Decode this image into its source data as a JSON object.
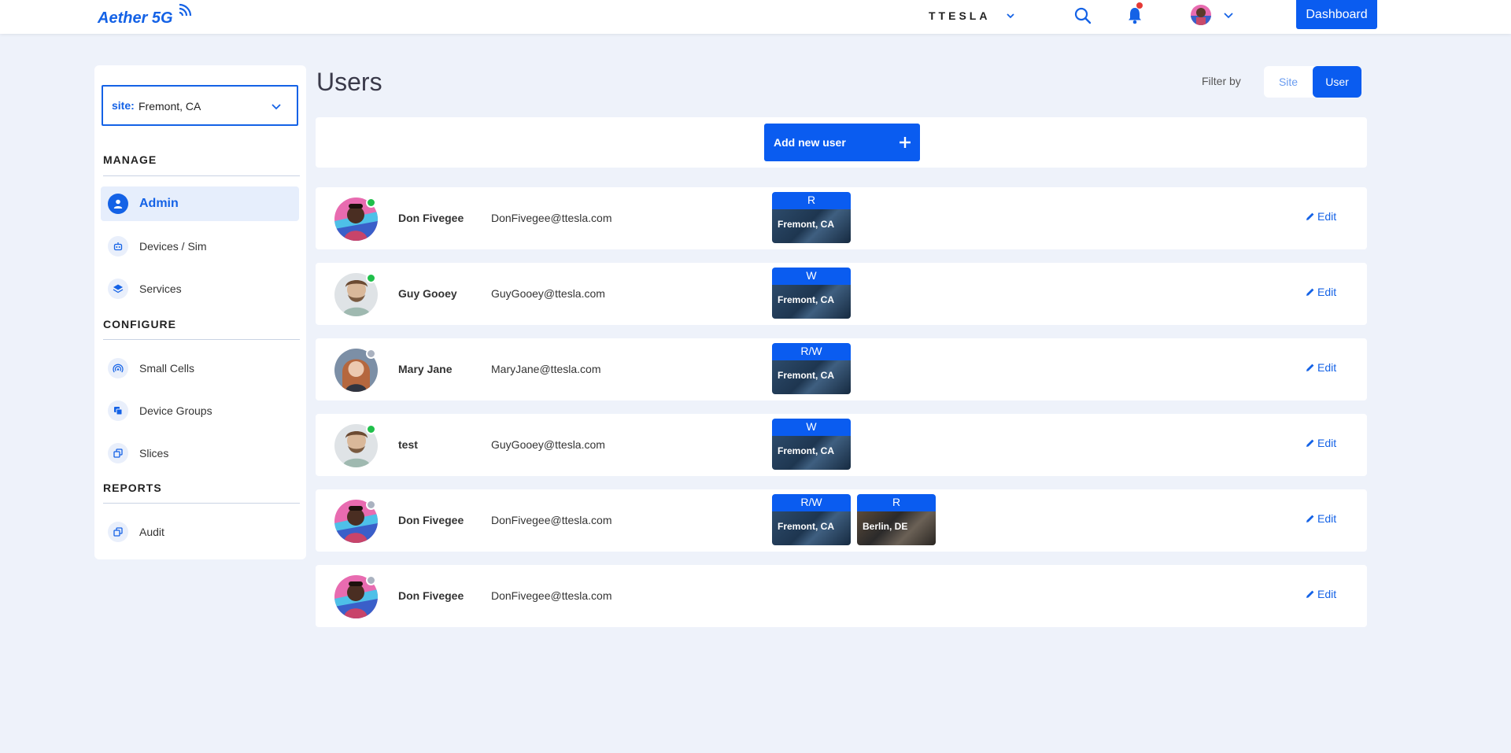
{
  "header": {
    "logo_text": "Aether 5G",
    "brand": "TTESLA",
    "dashboard_label": "Dashboard"
  },
  "sidebar": {
    "site_label": "site:",
    "site_value": "Fremont, CA",
    "sections": [
      {
        "title": "MANAGE",
        "items": [
          {
            "label": "Admin",
            "icon": "person-icon",
            "active": true
          },
          {
            "label": "Devices / Sim",
            "icon": "robot-icon"
          },
          {
            "label": "Services",
            "icon": "layers-icon"
          }
        ]
      },
      {
        "title": "CONFIGURE",
        "items": [
          {
            "label": "Small Cells",
            "icon": "signal-icon"
          },
          {
            "label": "Device Groups",
            "icon": "copy-icon"
          },
          {
            "label": "Slices",
            "icon": "stack-icon"
          }
        ]
      },
      {
        "title": "REPORTS",
        "items": [
          {
            "label": "Audit",
            "icon": "stack-icon"
          }
        ]
      }
    ]
  },
  "main": {
    "title": "Users",
    "filter_label": "Filter by",
    "filter_site": "Site",
    "filter_user": "User",
    "add_user_label": "Add new user",
    "edit_label": "Edit",
    "users": [
      {
        "name": "Don Fivegee",
        "email": "DonFivegee@ttesla.com",
        "status": "online",
        "avatar": "don",
        "sites": [
          {
            "perm": "R",
            "city": "Fremont, CA"
          }
        ]
      },
      {
        "name": "Guy Gooey",
        "email": "GuyGooey@ttesla.com",
        "status": "online",
        "avatar": "guy",
        "sites": [
          {
            "perm": "W",
            "city": "Fremont, CA"
          }
        ]
      },
      {
        "name": "Mary Jane",
        "email": "MaryJane@ttesla.com",
        "status": "offline",
        "avatar": "mary",
        "sites": [
          {
            "perm": "R/W",
            "city": "Fremont, CA"
          }
        ]
      },
      {
        "name": "test",
        "email": "GuyGooey@ttesla.com",
        "status": "online",
        "avatar": "guy",
        "sites": [
          {
            "perm": "W",
            "city": "Fremont, CA"
          }
        ]
      },
      {
        "name": "Don Fivegee",
        "email": "DonFivegee@ttesla.com",
        "status": "offline",
        "avatar": "don",
        "sites": [
          {
            "perm": "R/W",
            "city": "Fremont, CA"
          },
          {
            "perm": "R",
            "city": "Berlin, DE"
          }
        ]
      },
      {
        "name": "Don Fivegee",
        "email": "DonFivegee@ttesla.com",
        "status": "offline",
        "avatar": "don",
        "sites": []
      }
    ]
  },
  "colors": {
    "accent": "#0a5cf0",
    "online": "#1fbf4a",
    "offline": "#aab2c0",
    "background": "#eef2fa"
  }
}
